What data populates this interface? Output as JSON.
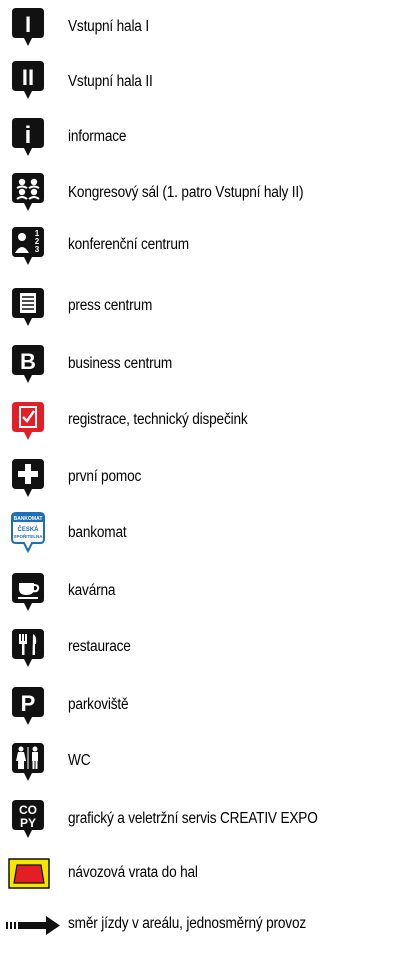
{
  "legend": [
    {
      "icon": "entrance-hall-1-icon",
      "label": "Vstupní hala I",
      "glyph": "I"
    },
    {
      "icon": "entrance-hall-2-icon",
      "label": "Vstupní hala II",
      "glyph": "II"
    },
    {
      "icon": "information-icon",
      "label": "informace",
      "glyph": "i"
    },
    {
      "icon": "congress-hall-icon",
      "label": "Kongresový sál  (1. patro Vstupní haly II)"
    },
    {
      "icon": "conference-centre-icon",
      "label": "konferenční centrum"
    },
    {
      "icon": "press-centre-icon",
      "label": "press centrum"
    },
    {
      "icon": "business-centre-icon",
      "label": "business centrum",
      "glyph": "B"
    },
    {
      "icon": "registration-icon",
      "label": "registrace, technický dispečink"
    },
    {
      "icon": "first-aid-icon",
      "label": "první pomoc"
    },
    {
      "icon": "atm-icon",
      "label": "bankomat",
      "sub": [
        "BANKOMAT",
        "ČESKÁ",
        "SPOŘITELNA"
      ]
    },
    {
      "icon": "cafe-icon",
      "label": "kavárna"
    },
    {
      "icon": "restaurant-icon",
      "label": "restaurace"
    },
    {
      "icon": "parking-icon",
      "label": "parkoviště",
      "glyph": "P"
    },
    {
      "icon": "wc-icon",
      "label": "WC"
    },
    {
      "icon": "copy-service-icon",
      "label": "grafický a veletržní servis CREATIV EXPO",
      "sub": [
        "CO",
        "PY"
      ]
    },
    {
      "icon": "loading-gate-icon",
      "label": "návozová vrata do hal"
    },
    {
      "icon": "one-way-arrow-icon",
      "label": "směr jízdy v areálu, jednosměrný provoz"
    }
  ],
  "colors": {
    "pin": "#111111",
    "registration": "#e31e24",
    "atm": "#1e6fb8",
    "gate_fill": "#f5e600",
    "gate_inner": "#e31e24"
  }
}
